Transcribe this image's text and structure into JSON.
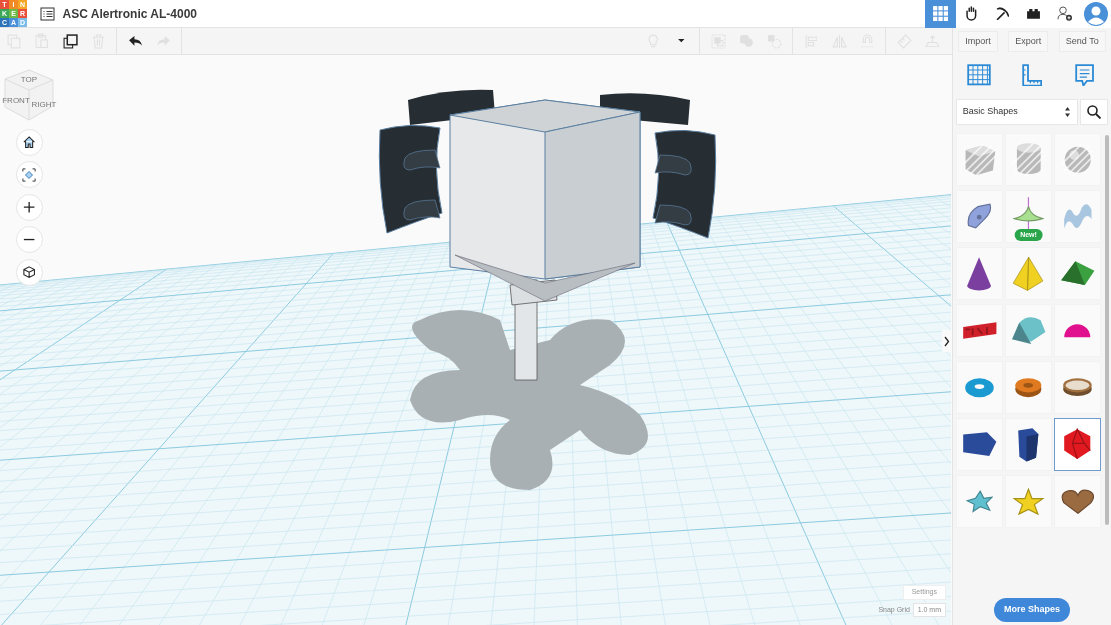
{
  "header": {
    "logo": [
      {
        "letter": "T",
        "color": "#e9503a"
      },
      {
        "letter": "I",
        "color": "#f08a24"
      },
      {
        "letter": "N",
        "color": "#f5a623"
      },
      {
        "letter": "K",
        "color": "#3aa656"
      },
      {
        "letter": "E",
        "color": "#6cb947"
      },
      {
        "letter": "R",
        "color": "#e9503a"
      },
      {
        "letter": "C",
        "color": "#2d73b9"
      },
      {
        "letter": "A",
        "color": "#4a90d9"
      },
      {
        "letter": "D",
        "color": "#7cbce8"
      }
    ],
    "title": "ASC Alertronic AL-4000",
    "modes": [
      {
        "kind": "grid",
        "selected": true
      },
      {
        "kind": "hand",
        "selected": false
      },
      {
        "kind": "pickaxe",
        "selected": false
      },
      {
        "kind": "brick",
        "selected": false
      }
    ]
  },
  "toolbar": {
    "edit_tools": [
      {
        "kind": "copy",
        "disabled": true
      },
      {
        "kind": "paste",
        "disabled": true
      },
      {
        "kind": "duplicate",
        "disabled": false
      },
      {
        "kind": "delete",
        "disabled": true
      },
      {
        "kind": "undo",
        "disabled": false
      },
      {
        "kind": "redo",
        "disabled": true
      }
    ],
    "shape_tools": [
      {
        "kind": "bulb",
        "disabled": true
      },
      {
        "kind": "caret",
        "disabled": false
      },
      {
        "kind": "group",
        "disabled": true
      },
      {
        "kind": "solid",
        "disabled": true
      },
      {
        "kind": "hole",
        "disabled": true
      },
      {
        "kind": "align",
        "disabled": true
      },
      {
        "kind": "mirror",
        "disabled": true
      },
      {
        "kind": "magnet",
        "disabled": true
      },
      {
        "kind": "ruler",
        "disabled": true
      },
      {
        "kind": "workplane",
        "disabled": true
      }
    ]
  },
  "panel": {
    "actions": [
      "Import",
      "Export",
      "Send To"
    ],
    "views": [
      {
        "kind": "grid"
      },
      {
        "kind": "ruler"
      },
      {
        "kind": "notes"
      }
    ],
    "category": "Basic Shapes",
    "shapes": [
      {
        "kind": "box",
        "color": "#b8b8b8",
        "hole": true,
        "selected": false
      },
      {
        "kind": "cylinder",
        "color": "#b8b8b8",
        "hole": true,
        "selected": false
      },
      {
        "kind": "sphere",
        "color": "#b8b8b8",
        "hole": true,
        "selected": false
      },
      {
        "kind": "scribble",
        "color": "#8fa2dc",
        "hole": false,
        "selected": false
      },
      {
        "kind": "paraboloid",
        "color": "#a8e090",
        "hole": false,
        "selected": false,
        "badge": "New!"
      },
      {
        "kind": "wave",
        "color": "#a9c6e0",
        "hole": false,
        "selected": false
      },
      {
        "kind": "cone",
        "color": "#7b3fa0",
        "hole": false,
        "selected": false
      },
      {
        "kind": "pyramid",
        "color": "#f0d020",
        "hole": false,
        "selected": false
      },
      {
        "kind": "roof",
        "color": "#3aa040",
        "hole": false,
        "selected": false
      },
      {
        "kind": "text",
        "color": "#d0202a",
        "hole": false,
        "selected": false
      },
      {
        "kind": "round-roof",
        "color": "#6cc0c8",
        "hole": false,
        "selected": false
      },
      {
        "kind": "half-sphere",
        "color": "#e0108f",
        "hole": false,
        "selected": false
      },
      {
        "kind": "torus",
        "color": "#1a9ad0",
        "hole": false,
        "selected": false
      },
      {
        "kind": "tube",
        "color": "#e07a20",
        "hole": false,
        "selected": false
      },
      {
        "kind": "ring",
        "color": "#a07040",
        "hole": false,
        "selected": false
      },
      {
        "kind": "polygon",
        "color": "#2a4a9a",
        "hole": false,
        "selected": false
      },
      {
        "kind": "prism",
        "color": "#2a4a9a",
        "hole": false,
        "selected": false
      },
      {
        "kind": "icosahedron",
        "color": "#e01a20",
        "hole": false,
        "selected": true
      },
      {
        "kind": "star",
        "color": "#60c0d0",
        "hole": false,
        "selected": false
      },
      {
        "kind": "star-3d",
        "color": "#f0d020",
        "hole": false,
        "selected": false
      },
      {
        "kind": "heart",
        "color": "#9a6a40",
        "hole": false,
        "selected": false
      }
    ],
    "more_button": "More Shapes"
  },
  "viewcube": {
    "top": "TOP",
    "front": "FRONT",
    "right": "RIGHT"
  },
  "nav": [
    {
      "kind": "home"
    },
    {
      "kind": "fit"
    },
    {
      "kind": "zoom-in"
    },
    {
      "kind": "zoom-out"
    },
    {
      "kind": "ortho"
    }
  ],
  "settings": {
    "label": "Settings",
    "snap_label": "Snap Grid",
    "snap_value": "1.0 mm"
  }
}
